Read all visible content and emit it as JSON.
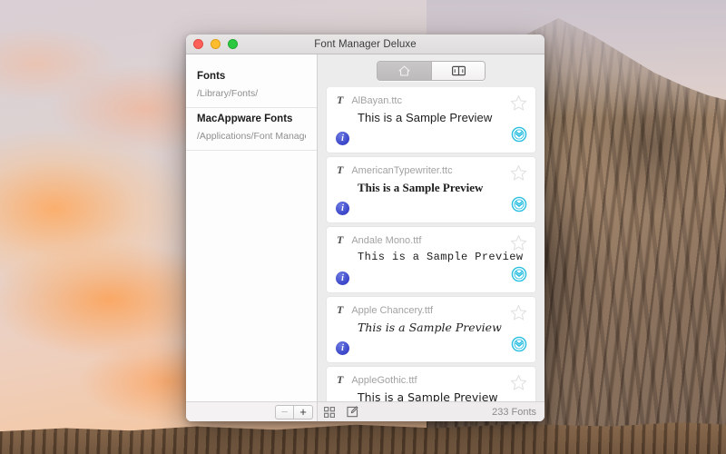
{
  "desktop": {
    "wallpaper_name": "el-capitan-sunset-wallpaper"
  },
  "window": {
    "title": "Font Manager Deluxe",
    "traffic_lights": [
      {
        "name": "close-button",
        "color": "#fe6059"
      },
      {
        "name": "minimize-button",
        "color": "#febd2f"
      },
      {
        "name": "zoom-button",
        "color": "#2bc840"
      }
    ]
  },
  "sidebar": {
    "groups": [
      {
        "title": "Fonts",
        "path": "/Library/Fonts/"
      },
      {
        "title": "MacAppware Fonts",
        "path": "/Applications/Font Manage"
      }
    ],
    "footer": {
      "remove_label": "−",
      "add_label": "+"
    }
  },
  "toolbar": {
    "segments": [
      {
        "icon": "home-icon",
        "label": "",
        "selected": true
      },
      {
        "icon": "book-icon",
        "label": "",
        "selected": false
      }
    ]
  },
  "font_list": [
    {
      "type_icon": "T",
      "name": "AlBayan.ttc",
      "preview": "This is a Sample Preview",
      "preview_style": "sans",
      "info_label": "i",
      "starred": false,
      "installed": true
    },
    {
      "type_icon": "T",
      "name": "AmericanTypewriter.ttc",
      "preview": "This is a Sample Preview",
      "preview_style": "serif",
      "info_label": "i",
      "starred": false,
      "installed": true
    },
    {
      "type_icon": "T",
      "name": "Andale Mono.ttf",
      "preview": "This is a Sample Preview",
      "preview_style": "mono",
      "info_label": "i",
      "starred": false,
      "installed": true
    },
    {
      "type_icon": "T",
      "name": "Apple Chancery.ttf",
      "preview": "This is a Sample Preview",
      "preview_style": "script",
      "info_label": "i",
      "starred": false,
      "installed": true
    },
    {
      "type_icon": "T",
      "name": "AppleGothic.ttf",
      "preview": "This is a Sample Preview",
      "preview_style": "gothic",
      "info_label": "i",
      "starred": false,
      "installed": true
    }
  ],
  "bottom_bar": {
    "grid_view_icon": "grid-view-icon",
    "compose_icon": "compose-icon",
    "count_label": "233 Fonts"
  },
  "colors": {
    "accent_info": "#3a46c8",
    "accent_installed": "#29bfe0",
    "star_outline": "#e2e0e0",
    "window_bg": "#ececec",
    "card_bg": "#ffffff"
  }
}
